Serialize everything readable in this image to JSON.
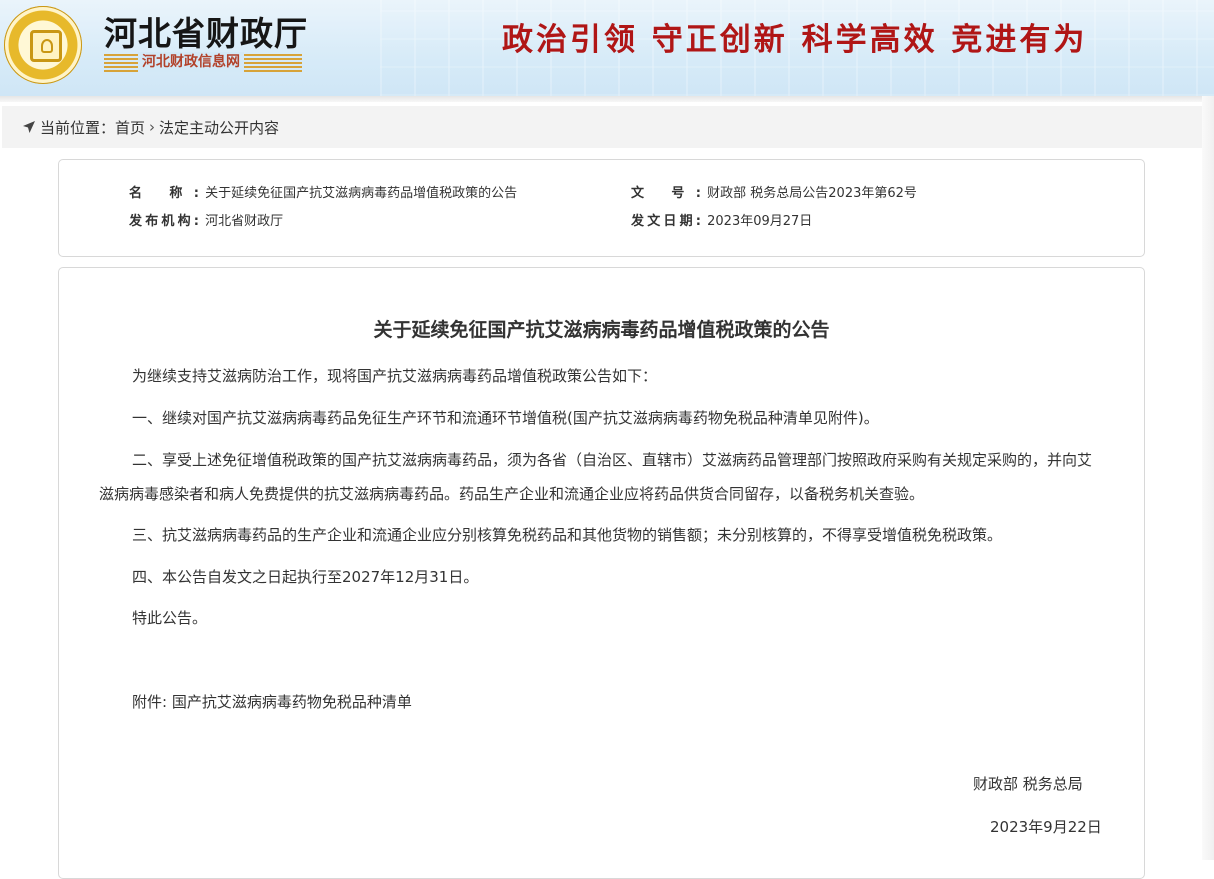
{
  "header": {
    "site_title": "河北省财政厅",
    "site_subtitle": "河北财政信息网",
    "slogan": "政治引领  守正创新  科学高效  竞进有为",
    "colors": {
      "slogan": "#b01616",
      "banner": "#d7ebf8"
    }
  },
  "breadcrumb": {
    "label": "当前位置：",
    "home": "首页",
    "separator": "›",
    "current": "法定主动公开内容"
  },
  "info": {
    "name_key": "名      称:",
    "name_value": "关于延续免征国产抗艾滋病病毒药品增值税政策的公告",
    "docno_key": "文      号:",
    "docno_value": "财政部 税务总局公告2023年第62号",
    "publisher_key": "发布机构:",
    "publisher_value": "河北省财政厅",
    "date_key": "发文日期:",
    "date_value": "2023年09月27日"
  },
  "article": {
    "title": "关于延续免征国产抗艾滋病病毒药品增值税政策的公告",
    "intro": "为继续支持艾滋病防治工作，现将国产抗艾滋病病毒药品增值税政策公告如下：",
    "item1": "一、继续对国产抗艾滋病病毒药品免征生产环节和流通环节增值税(国产抗艾滋病病毒药物免税品种清单见附件)。",
    "item2": "二、享受上述免征增值税政策的国产抗艾滋病病毒药品，须为各省（自治区、直辖市）艾滋病药品管理部门按照政府采购有关规定采购的，并向艾滋病病毒感染者和病人免费提供的抗艾滋病病毒药品。药品生产企业和流通企业应将药品供货合同留存，以备税务机关查验。",
    "item3": "三、抗艾滋病病毒药品的生产企业和流通企业应分别核算免税药品和其他货物的销售额；未分别核算的，不得享受增值税免税政策。",
    "item4": "四、本公告自发文之日起执行至2027年12月31日。",
    "closing": "特此公告。",
    "attachment": "附件: 国产抗艾滋病病毒药物免税品种清单",
    "signatory": "财政部  税务总局",
    "sign_date": "2023年9月22日"
  }
}
